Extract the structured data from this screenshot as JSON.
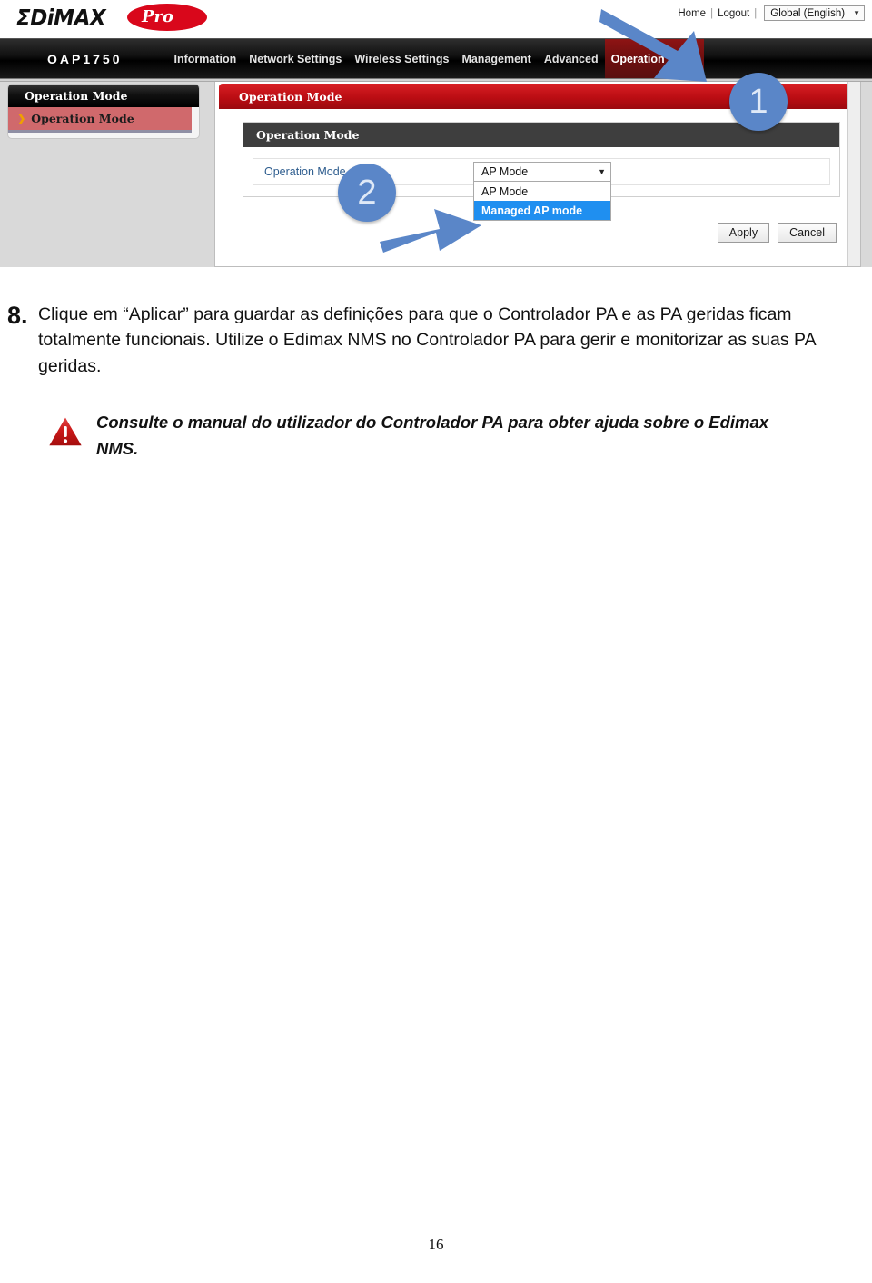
{
  "screenshot": {
    "brand": {
      "name": "ΣDiMAX",
      "badge": "Pro"
    },
    "top_links": {
      "home": "Home",
      "separator": "|",
      "logout": "Logout",
      "language": "Global (English)",
      "caret_icon": "chevron-down-icon"
    },
    "nav": {
      "model": "OAP1750",
      "items": [
        {
          "label": "Information",
          "active": false
        },
        {
          "label": "Network Settings",
          "active": false
        },
        {
          "label": "Wireless Settings",
          "active": false
        },
        {
          "label": "Management",
          "active": false
        },
        {
          "label": "Advanced",
          "active": false
        },
        {
          "label": "Operation Mode",
          "active": true
        }
      ]
    },
    "sidebar": {
      "header": "Operation Mode",
      "items": [
        {
          "label": "Operation Mode",
          "chevron_icon": "chevron-right-icon",
          "selected": true
        }
      ]
    },
    "panel": {
      "title": "Operation Mode",
      "section_title": "Operation Mode",
      "field_label": "Operation Mode",
      "select": {
        "value": "AP Mode",
        "caret_icon": "chevron-down-icon",
        "options": [
          {
            "label": "AP Mode",
            "selected": false
          },
          {
            "label": "Managed AP mode",
            "selected": true
          }
        ]
      },
      "buttons": {
        "apply": "Apply",
        "cancel": "Cancel"
      }
    },
    "callouts": [
      {
        "number": "1",
        "target": "operation-mode-tab"
      },
      {
        "number": "2",
        "target": "managed-ap-mode-option"
      }
    ],
    "colors": {
      "callout_blue": "#5a86c8",
      "nav_active_red": "#6d0f0f",
      "panel_title_red": "#bb0d13",
      "sidebar_item_red": "#d0696c",
      "option_highlight_blue": "#1f8ff0",
      "brand_red": "#d9071b"
    }
  },
  "document": {
    "step": {
      "number": "8.",
      "text": "Clique em “Aplicar” para guardar as definições para que o Controlador PA e as PA geridas ficam totalmente funcionais. Utilize o Edimax NMS no Controlador PA para gerir e monitorizar as suas PA geridas."
    },
    "note": {
      "icon": "warning-triangle-icon",
      "text": "Consulte o manual do utilizador do Controlador PA para obter ajuda sobre o Edimax NMS."
    },
    "page_number": "16"
  }
}
